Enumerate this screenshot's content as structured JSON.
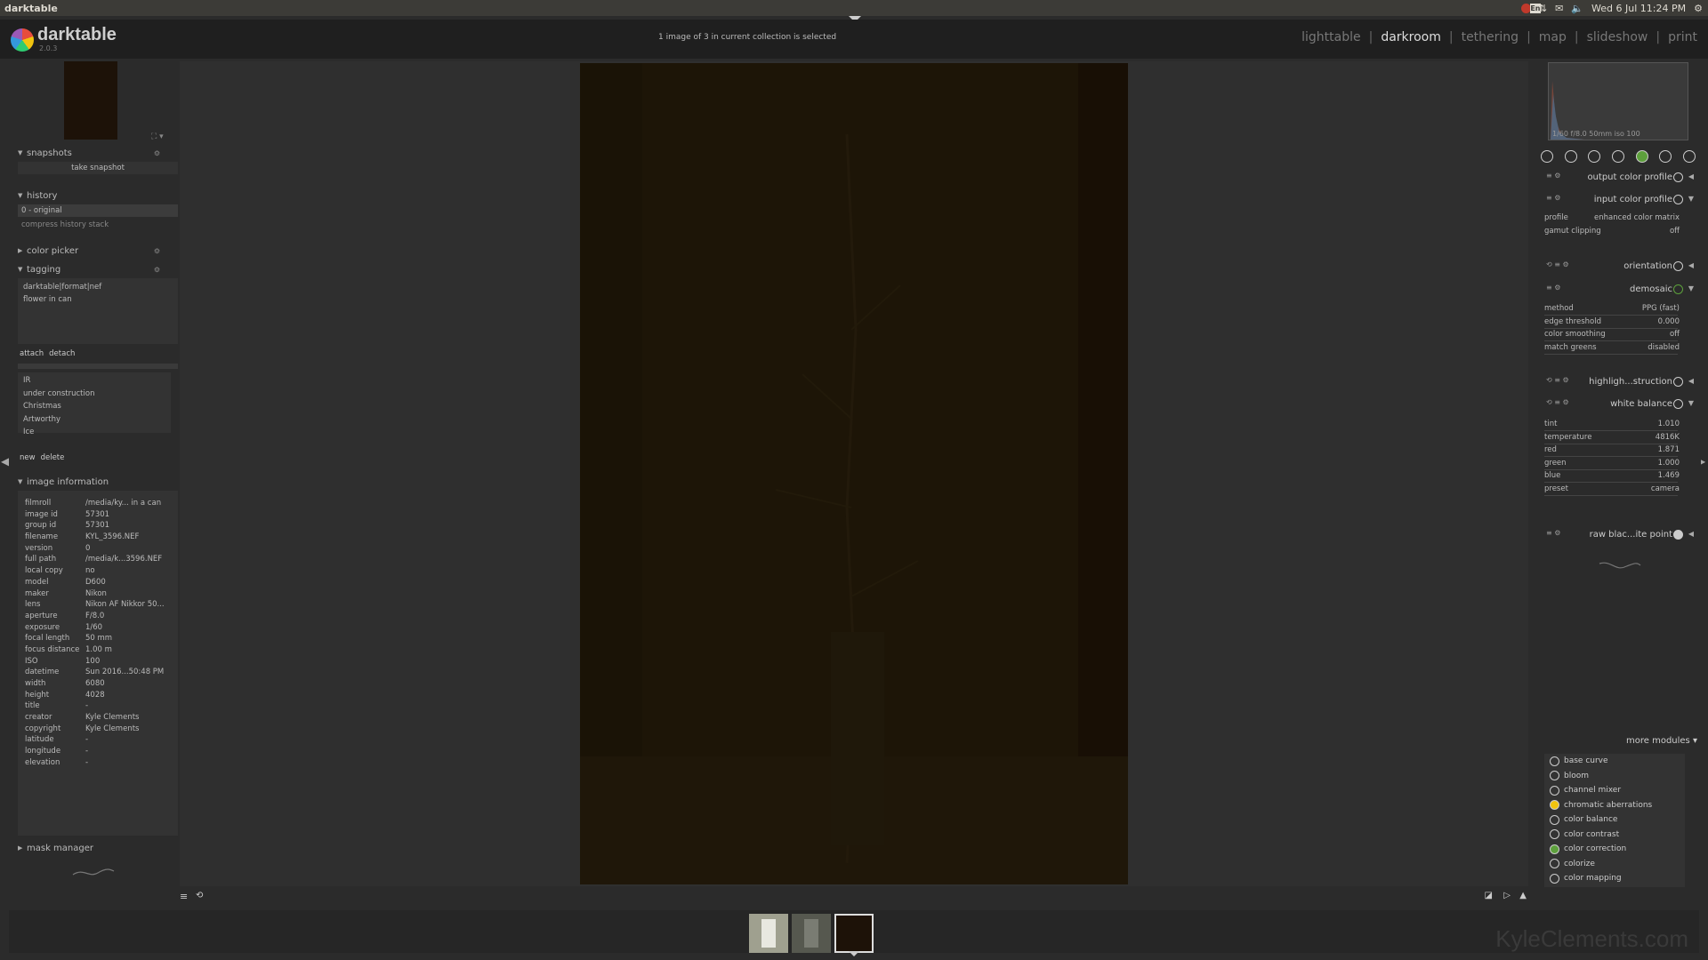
{
  "topbar": {
    "app_name": "darktable",
    "datetime": "Wed 6 Jul 11:24 PM",
    "keyboard_layout": "En"
  },
  "header": {
    "logo_name": "darktable",
    "logo_version": "2.0.3",
    "collection_info": "1 image of 3 in current collection is selected"
  },
  "views": {
    "lighttable": "lighttable",
    "darkroom": "darkroom",
    "tethering": "tethering",
    "map": "map",
    "slideshow": "slideshow",
    "print": "print",
    "separator": "|"
  },
  "left": {
    "snapshots": {
      "title": "snapshots",
      "take_snapshot": "take snapshot"
    },
    "history": {
      "title": "history",
      "item0": "0 - original",
      "compress": "compress history stack"
    },
    "color_picker": {
      "title": "color picker"
    },
    "tagging": {
      "title": "tagging",
      "attached": [
        "darktable|format|nef",
        "flower in can"
      ],
      "attach": "attach",
      "detach": "detach",
      "dictionary": [
        "IR",
        "under construction",
        "Christmas",
        "Artworthy",
        "Ice"
      ],
      "new": "new",
      "delete": "delete"
    },
    "image_information": {
      "title": "image information",
      "rows": [
        [
          "filmroll",
          "/media/ky... in a can"
        ],
        [
          "image id",
          "57301"
        ],
        [
          "group id",
          "57301"
        ],
        [
          "filename",
          "KYL_3596.NEF"
        ],
        [
          "version",
          "0"
        ],
        [
          "full path",
          "/media/k...3596.NEF"
        ],
        [
          "local copy",
          "no"
        ],
        [
          "model",
          "D600"
        ],
        [
          "maker",
          "Nikon"
        ],
        [
          "lens",
          "Nikon AF Nikkor 50..."
        ],
        [
          "aperture",
          "F/8.0"
        ],
        [
          "exposure",
          "1/60"
        ],
        [
          "focal length",
          "50 mm"
        ],
        [
          "focus distance",
          "1.00 m"
        ],
        [
          "ISO",
          "100"
        ],
        [
          "datetime",
          "Sun 2016...50:48 PM"
        ],
        [
          "width",
          "6080"
        ],
        [
          "height",
          "4028"
        ],
        [
          "title",
          "-"
        ],
        [
          "creator",
          "Kyle Clements"
        ],
        [
          "copyright",
          "Kyle Clements"
        ],
        [
          "latitude",
          "-"
        ],
        [
          "longitude",
          "-"
        ],
        [
          "elevation",
          "-"
        ]
      ]
    },
    "mask_manager": {
      "title": "mask manager"
    }
  },
  "right": {
    "histogram_info": "1/60 f/8.0 50mm iso 100",
    "modules": {
      "output_color_profile": "output color profile",
      "input_color_profile": "input color profile",
      "orientation": "orientation",
      "demosaic": "demosaic",
      "highlight": "highligh...struction",
      "white_balance": "white balance",
      "raw_black": "raw blac...ite point"
    },
    "input_params": [
      [
        "profile",
        "enhanced color matrix"
      ],
      [
        "gamut clipping",
        "off"
      ]
    ],
    "demosaic_params": [
      [
        "method",
        "PPG (fast)"
      ],
      [
        "edge threshold",
        "0.000"
      ],
      [
        "color smoothing",
        "off"
      ],
      [
        "match greens",
        "disabled"
      ]
    ],
    "wb_params": [
      [
        "tint",
        "1.010"
      ],
      [
        "temperature",
        "4816K"
      ],
      [
        "red",
        "1.871"
      ],
      [
        "green",
        "1.000"
      ],
      [
        "blue",
        "1.469"
      ],
      [
        "preset",
        "camera"
      ]
    ],
    "more_modules": "more modules",
    "module_list": [
      "base curve",
      "bloom",
      "channel mixer",
      "chromatic aberrations",
      "color balance",
      "color contrast",
      "color correction",
      "colorize",
      "color mapping"
    ]
  },
  "watermark": "KyleClements.com",
  "colors": {
    "accent": "#5da03c",
    "photo_bg": "#1d1507"
  }
}
